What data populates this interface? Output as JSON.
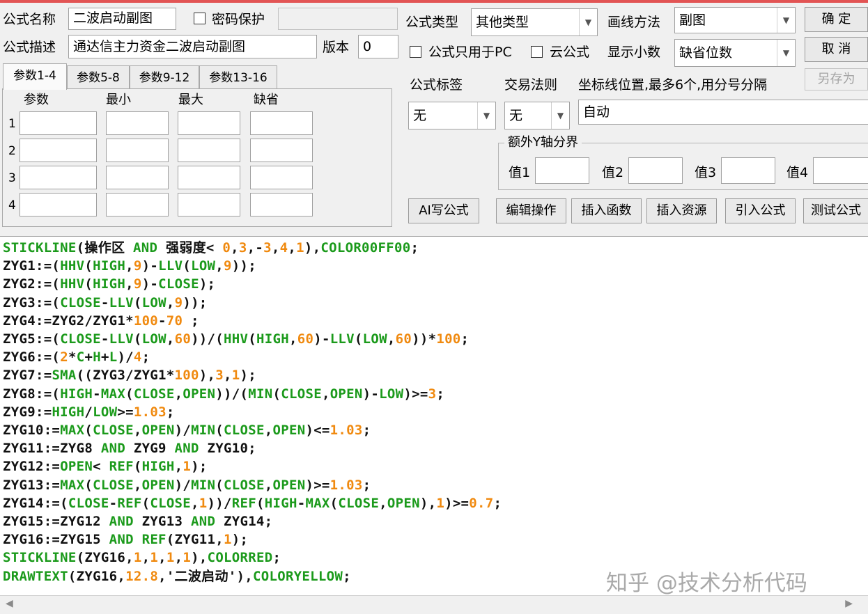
{
  "form": {
    "name_label": "公式名称",
    "name_value": "二波启动副图",
    "password_label": "密码保护",
    "password_value": "",
    "desc_label": "公式描述",
    "desc_value": "通达信主力资金二波启动副图",
    "version_label": "版本",
    "version_value": "0",
    "type_label": "公式类型",
    "type_value": "其他类型",
    "draw_label": "画线方法",
    "draw_value": "副图",
    "pc_only_label": "公式只用于PC",
    "cloud_label": "云公式",
    "decimal_label": "显示小数",
    "decimal_value": "缺省位数",
    "tag_label": "公式标签",
    "tag_value": "无",
    "trade_label": "交易法则",
    "trade_value": "无",
    "axis_label": "坐标线位置,最多6个,用分号分隔",
    "axis_value": "自动",
    "extra_y_label": "额外Y轴分界",
    "y1_label": "值1",
    "y2_label": "值2",
    "y3_label": "值3",
    "y4_label": "值4"
  },
  "buttons": {
    "ok": "确 定",
    "cancel": "取 消",
    "save_as": "另存为",
    "ai": "AI写公式",
    "edit_ops": "编辑操作",
    "insert_func": "插入函数",
    "insert_res": "插入资源",
    "import": "引入公式",
    "test": "测试公式"
  },
  "tabs": [
    "参数1-4",
    "参数5-8",
    "参数9-12",
    "参数13-16"
  ],
  "param_table": {
    "headers": [
      "参数",
      "最小",
      "最大",
      "缺省"
    ],
    "rows": [
      "1",
      "2",
      "3",
      "4"
    ]
  },
  "code_lines": [
    [
      [
        "f",
        "STICKLINE"
      ],
      [
        "t",
        "(操作区 "
      ],
      [
        "k",
        "AND"
      ],
      [
        "t",
        " 强弱度< "
      ],
      [
        "n",
        "0"
      ],
      [
        "t",
        ","
      ],
      [
        "n",
        "3"
      ],
      [
        "t",
        ",-"
      ],
      [
        "n",
        "3"
      ],
      [
        "t",
        ","
      ],
      [
        "n",
        "4"
      ],
      [
        "t",
        ","
      ],
      [
        "n",
        "1"
      ],
      [
        "t",
        "),"
      ],
      [
        "f",
        "COLOR00FF00"
      ],
      [
        "t",
        ";"
      ]
    ],
    [
      [
        "t",
        "ZYG1:=("
      ],
      [
        "f",
        "HHV"
      ],
      [
        "t",
        "("
      ],
      [
        "f",
        "HIGH"
      ],
      [
        "t",
        ","
      ],
      [
        "n",
        "9"
      ],
      [
        "t",
        ")-"
      ],
      [
        "f",
        "LLV"
      ],
      [
        "t",
        "("
      ],
      [
        "f",
        "LOW"
      ],
      [
        "t",
        ","
      ],
      [
        "n",
        "9"
      ],
      [
        "t",
        "));"
      ]
    ],
    [
      [
        "t",
        "ZYG2:=("
      ],
      [
        "f",
        "HHV"
      ],
      [
        "t",
        "("
      ],
      [
        "f",
        "HIGH"
      ],
      [
        "t",
        ","
      ],
      [
        "n",
        "9"
      ],
      [
        "t",
        ")-"
      ],
      [
        "f",
        "CLOSE"
      ],
      [
        "t",
        ");"
      ]
    ],
    [
      [
        "t",
        "ZYG3:=("
      ],
      [
        "f",
        "CLOSE"
      ],
      [
        "t",
        "-"
      ],
      [
        "f",
        "LLV"
      ],
      [
        "t",
        "("
      ],
      [
        "f",
        "LOW"
      ],
      [
        "t",
        ","
      ],
      [
        "n",
        "9"
      ],
      [
        "t",
        "));"
      ]
    ],
    [
      [
        "t",
        "ZYG4:=ZYG2/ZYG1*"
      ],
      [
        "n",
        "100"
      ],
      [
        "t",
        "-"
      ],
      [
        "n",
        "70"
      ],
      [
        "t",
        " ;"
      ]
    ],
    [
      [
        "t",
        "ZYG5:=("
      ],
      [
        "f",
        "CLOSE"
      ],
      [
        "t",
        "-"
      ],
      [
        "f",
        "LLV"
      ],
      [
        "t",
        "("
      ],
      [
        "f",
        "LOW"
      ],
      [
        "t",
        ","
      ],
      [
        "n",
        "60"
      ],
      [
        "t",
        "))/("
      ],
      [
        "f",
        "HHV"
      ],
      [
        "t",
        "("
      ],
      [
        "f",
        "HIGH"
      ],
      [
        "t",
        ","
      ],
      [
        "n",
        "60"
      ],
      [
        "t",
        ")-"
      ],
      [
        "f",
        "LLV"
      ],
      [
        "t",
        "("
      ],
      [
        "f",
        "LOW"
      ],
      [
        "t",
        ","
      ],
      [
        "n",
        "60"
      ],
      [
        "t",
        "))*"
      ],
      [
        "n",
        "100"
      ],
      [
        "t",
        ";"
      ]
    ],
    [
      [
        "t",
        "ZYG6:=("
      ],
      [
        "n",
        "2"
      ],
      [
        "t",
        "*"
      ],
      [
        "f",
        "C"
      ],
      [
        "t",
        "+"
      ],
      [
        "f",
        "H"
      ],
      [
        "t",
        "+"
      ],
      [
        "f",
        "L"
      ],
      [
        "t",
        ")/"
      ],
      [
        "n",
        "4"
      ],
      [
        "t",
        ";"
      ]
    ],
    [
      [
        "t",
        "ZYG7:="
      ],
      [
        "f",
        "SMA"
      ],
      [
        "t",
        "((ZYG3/ZYG1*"
      ],
      [
        "n",
        "100"
      ],
      [
        "t",
        "),"
      ],
      [
        "n",
        "3"
      ],
      [
        "t",
        ","
      ],
      [
        "n",
        "1"
      ],
      [
        "t",
        ");"
      ]
    ],
    [
      [
        "t",
        "ZYG8:=("
      ],
      [
        "f",
        "HIGH"
      ],
      [
        "t",
        "-"
      ],
      [
        "f",
        "MAX"
      ],
      [
        "t",
        "("
      ],
      [
        "f",
        "CLOSE"
      ],
      [
        "t",
        ","
      ],
      [
        "f",
        "OPEN"
      ],
      [
        "t",
        "))/("
      ],
      [
        "f",
        "MIN"
      ],
      [
        "t",
        "("
      ],
      [
        "f",
        "CLOSE"
      ],
      [
        "t",
        ","
      ],
      [
        "f",
        "OPEN"
      ],
      [
        "t",
        ")-"
      ],
      [
        "f",
        "LOW"
      ],
      [
        "t",
        ")>="
      ],
      [
        "n",
        "3"
      ],
      [
        "t",
        ";"
      ]
    ],
    [
      [
        "t",
        "ZYG9:="
      ],
      [
        "f",
        "HIGH"
      ],
      [
        "t",
        "/"
      ],
      [
        "f",
        "LOW"
      ],
      [
        "t",
        ">="
      ],
      [
        "n",
        "1.03"
      ],
      [
        "t",
        ";"
      ]
    ],
    [
      [
        "t",
        "ZYG10:="
      ],
      [
        "f",
        "MAX"
      ],
      [
        "t",
        "("
      ],
      [
        "f",
        "CLOSE"
      ],
      [
        "t",
        ","
      ],
      [
        "f",
        "OPEN"
      ],
      [
        "t",
        ")/"
      ],
      [
        "f",
        "MIN"
      ],
      [
        "t",
        "("
      ],
      [
        "f",
        "CLOSE"
      ],
      [
        "t",
        ","
      ],
      [
        "f",
        "OPEN"
      ],
      [
        "t",
        ")<="
      ],
      [
        "n",
        "1.03"
      ],
      [
        "t",
        ";"
      ]
    ],
    [
      [
        "t",
        "ZYG11:=ZYG8 "
      ],
      [
        "k",
        "AND"
      ],
      [
        "t",
        " ZYG9 "
      ],
      [
        "k",
        "AND"
      ],
      [
        "t",
        " ZYG10;"
      ]
    ],
    [
      [
        "t",
        "ZYG12:="
      ],
      [
        "f",
        "OPEN"
      ],
      [
        "t",
        "< "
      ],
      [
        "f",
        "REF"
      ],
      [
        "t",
        "("
      ],
      [
        "f",
        "HIGH"
      ],
      [
        "t",
        ","
      ],
      [
        "n",
        "1"
      ],
      [
        "t",
        ");"
      ]
    ],
    [
      [
        "t",
        "ZYG13:="
      ],
      [
        "f",
        "MAX"
      ],
      [
        "t",
        "("
      ],
      [
        "f",
        "CLOSE"
      ],
      [
        "t",
        ","
      ],
      [
        "f",
        "OPEN"
      ],
      [
        "t",
        ")/"
      ],
      [
        "f",
        "MIN"
      ],
      [
        "t",
        "("
      ],
      [
        "f",
        "CLOSE"
      ],
      [
        "t",
        ","
      ],
      [
        "f",
        "OPEN"
      ],
      [
        "t",
        ")>="
      ],
      [
        "n",
        "1.03"
      ],
      [
        "t",
        ";"
      ]
    ],
    [
      [
        "t",
        "ZYG14:=("
      ],
      [
        "f",
        "CLOSE"
      ],
      [
        "t",
        "-"
      ],
      [
        "f",
        "REF"
      ],
      [
        "t",
        "("
      ],
      [
        "f",
        "CLOSE"
      ],
      [
        "t",
        ","
      ],
      [
        "n",
        "1"
      ],
      [
        "t",
        "))/"
      ],
      [
        "f",
        "REF"
      ],
      [
        "t",
        "("
      ],
      [
        "f",
        "HIGH"
      ],
      [
        "t",
        "-"
      ],
      [
        "f",
        "MAX"
      ],
      [
        "t",
        "("
      ],
      [
        "f",
        "CLOSE"
      ],
      [
        "t",
        ","
      ],
      [
        "f",
        "OPEN"
      ],
      [
        "t",
        "),"
      ],
      [
        "n",
        "1"
      ],
      [
        "t",
        ")>="
      ],
      [
        "n",
        "0.7"
      ],
      [
        "t",
        ";"
      ]
    ],
    [
      [
        "t",
        "ZYG15:=ZYG12 "
      ],
      [
        "k",
        "AND"
      ],
      [
        "t",
        " ZYG13 "
      ],
      [
        "k",
        "AND"
      ],
      [
        "t",
        " ZYG14;"
      ]
    ],
    [
      [
        "t",
        "ZYG16:=ZYG15 "
      ],
      [
        "k",
        "AND"
      ],
      [
        "t",
        " "
      ],
      [
        "f",
        "REF"
      ],
      [
        "t",
        "(ZYG11,"
      ],
      [
        "n",
        "1"
      ],
      [
        "t",
        ");"
      ]
    ],
    [
      [
        "f",
        "STICKLINE"
      ],
      [
        "t",
        "(ZYG16,"
      ],
      [
        "n",
        "1"
      ],
      [
        "t",
        ","
      ],
      [
        "n",
        "1"
      ],
      [
        "t",
        ","
      ],
      [
        "n",
        "1"
      ],
      [
        "t",
        ","
      ],
      [
        "n",
        "1"
      ],
      [
        "t",
        "),"
      ],
      [
        "f",
        "COLORRED"
      ],
      [
        "t",
        ";"
      ]
    ],
    [
      [
        "f",
        "DRAWTEXT"
      ],
      [
        "t",
        "(ZYG16,"
      ],
      [
        "n",
        "12.8"
      ],
      [
        "t",
        ",'二波启动'),"
      ],
      [
        "f",
        "COLORYELLOW"
      ],
      [
        "t",
        ";"
      ]
    ]
  ],
  "watermark": "知乎 @技术分析代码",
  "icons": {
    "combo": "chevron-down-icon",
    "scroll_left": "scroll-left-icon",
    "scroll_right": "scroll-right-icon"
  },
  "colors": {
    "function": "#1b9a1b",
    "number": "#f08a10",
    "text": "#111111"
  }
}
